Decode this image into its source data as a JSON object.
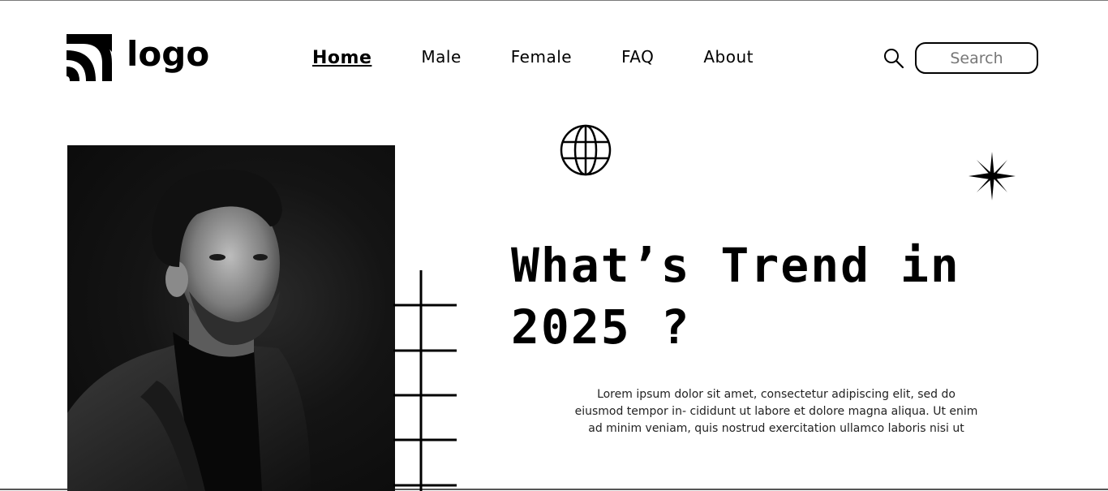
{
  "header": {
    "logo_text": "logo",
    "nav": [
      {
        "label": "Home",
        "active": true
      },
      {
        "label": "Male",
        "active": false
      },
      {
        "label": "Female",
        "active": false
      },
      {
        "label": "FAQ",
        "active": false
      },
      {
        "label": "About",
        "active": false
      }
    ],
    "search": {
      "placeholder": "Search",
      "icon": "search-icon"
    }
  },
  "hero": {
    "headline_line1": "What’s Trend in",
    "headline_line2": "2025 ?",
    "body": "Lorem ipsum dolor sit amet, consectetur adipiscing elit, sed do eiusmod tempor in- cididunt ut labore et dolore magna aliqua. Ut enim ad minim veniam, quis nostrud exercitation ullamco laboris nisi ut",
    "image": "portrait-photo",
    "decorations": [
      "globe-icon",
      "sparkle-icon",
      "ladder-grid"
    ]
  },
  "colors": {
    "background": "#ffffff",
    "text": "#000000",
    "placeholder": "#777777"
  }
}
